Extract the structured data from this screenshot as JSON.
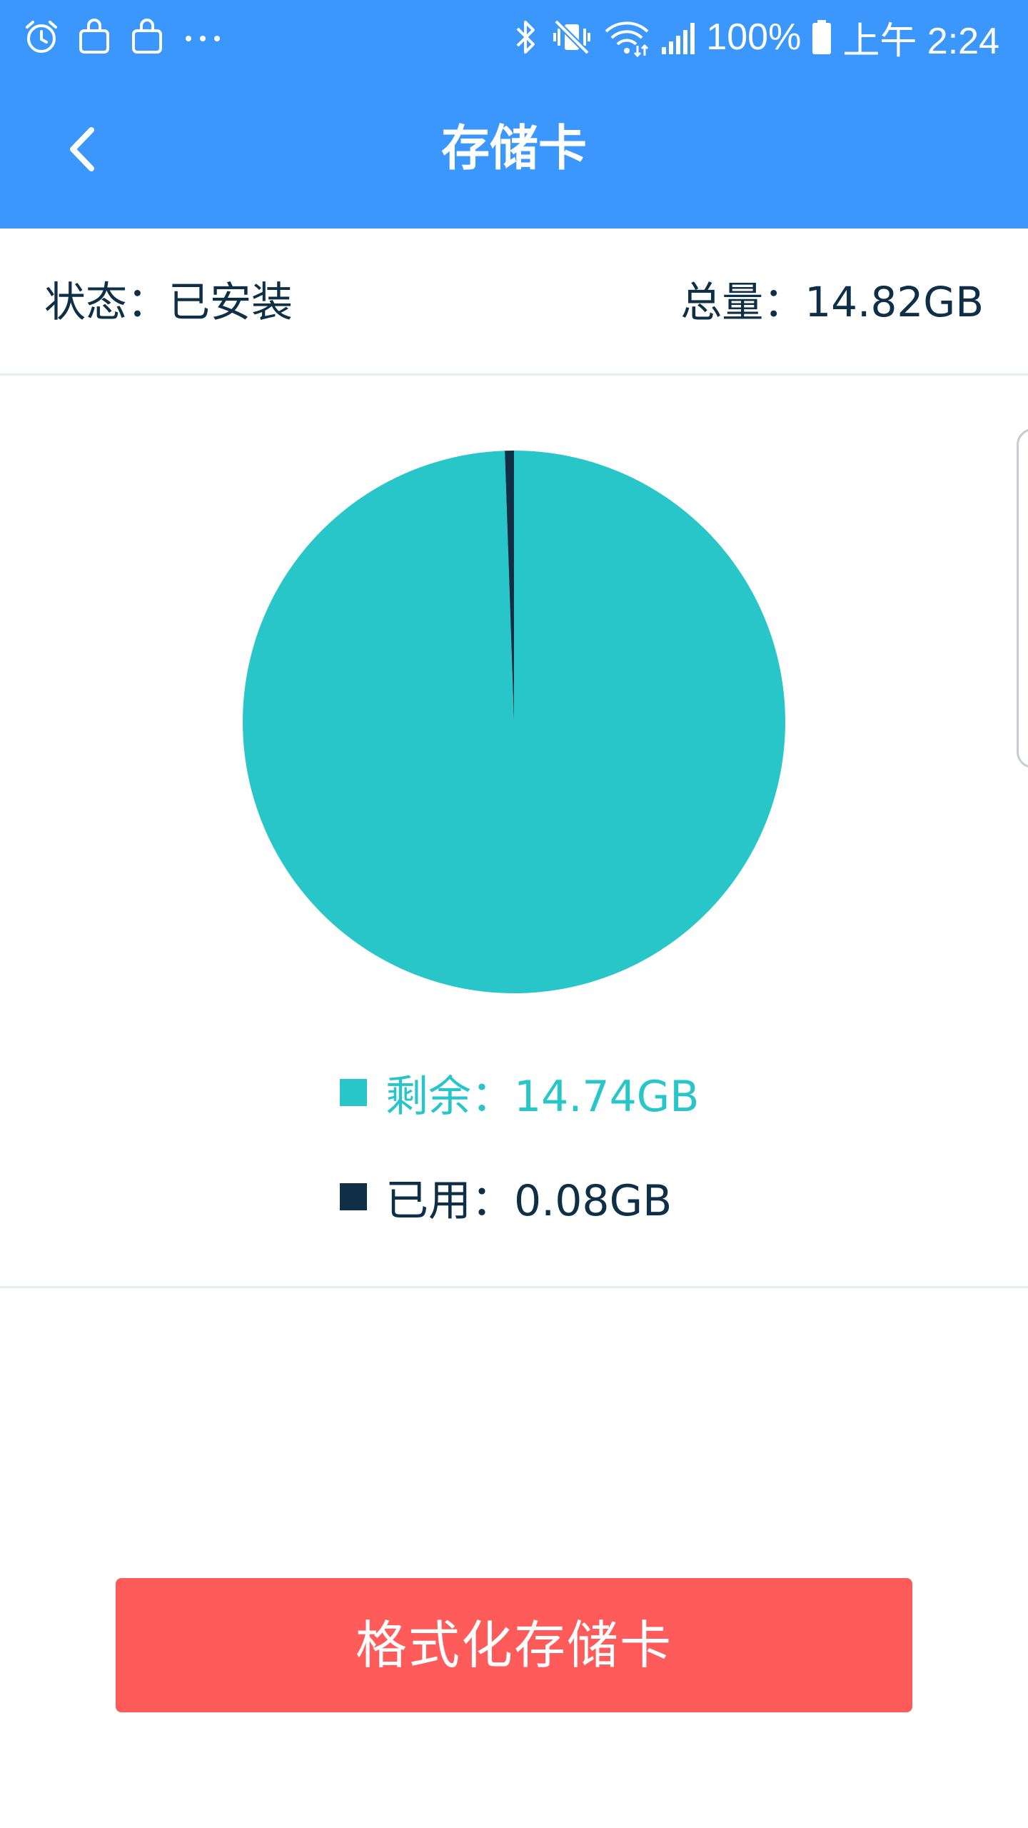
{
  "status_bar": {
    "battery": "100%",
    "time": "上午 2:24",
    "icons": [
      "alarm-icon",
      "shopping-bag-icon",
      "shopping-bag-icon",
      "more-dots-icon",
      "bluetooth-icon",
      "vibrate-mute-icon",
      "wifi-icon",
      "signal-icon",
      "battery-icon"
    ]
  },
  "app_bar": {
    "title": "存储卡",
    "back_icon": "chevron-left-icon"
  },
  "info": {
    "status": "状态：已安装",
    "total": "总量：14.82GB"
  },
  "chart_data": {
    "type": "pie",
    "slices": [
      {
        "label": "剩余",
        "value": 14.74,
        "unit": "GB",
        "color": "#28c6c9"
      },
      {
        "label": "已用",
        "value": 0.08,
        "unit": "GB",
        "color": "#0e2f45"
      }
    ]
  },
  "legend": {
    "remaining": "剩余：14.74GB",
    "used": "已用：0.08GB"
  },
  "colors": {
    "accent": "#3b97fb",
    "remaining": "#28c6c9",
    "used": "#0e2f45",
    "danger": "#ff5b5b"
  },
  "actions": {
    "format_label": "格式化存储卡"
  }
}
